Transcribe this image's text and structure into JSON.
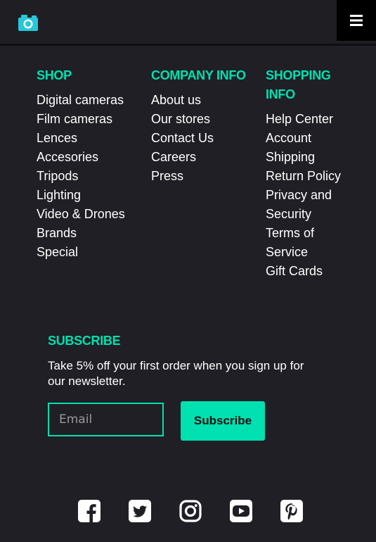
{
  "header": {
    "logo_icon": "camera-icon",
    "menu_icon": "hamburger-icon"
  },
  "footer": {
    "columns": [
      {
        "title": "SHOP",
        "links": [
          "Digital cameras",
          "Film cameras",
          "Lences",
          "Accesories",
          "Tripods",
          "Lighting",
          "Video & Drones",
          "Brands",
          "Special"
        ]
      },
      {
        "title": "COMPANY INFO",
        "links": [
          "About us",
          "Our stores",
          "Contact Us",
          "Careers",
          "Press"
        ]
      },
      {
        "title": "SHOPPING INFO",
        "links": [
          "Help Center",
          "Account",
          "Shipping",
          "Return Policy",
          "Privacy and Security",
          "Terms of Service",
          "Gift Cards"
        ]
      }
    ],
    "subscribe": {
      "title": "SUBSCRIBE",
      "text": "Take 5% off your first order when you sign up for our newsletter.",
      "email_placeholder": "Email",
      "button_label": "Subscribe"
    },
    "socials": [
      "facebook-icon",
      "twitter-icon",
      "instagram-icon",
      "youtube-icon",
      "pinterest-icon"
    ]
  },
  "colors": {
    "background": "#1f1f25",
    "accent": "#00e0b0",
    "text": "#ffffff"
  }
}
